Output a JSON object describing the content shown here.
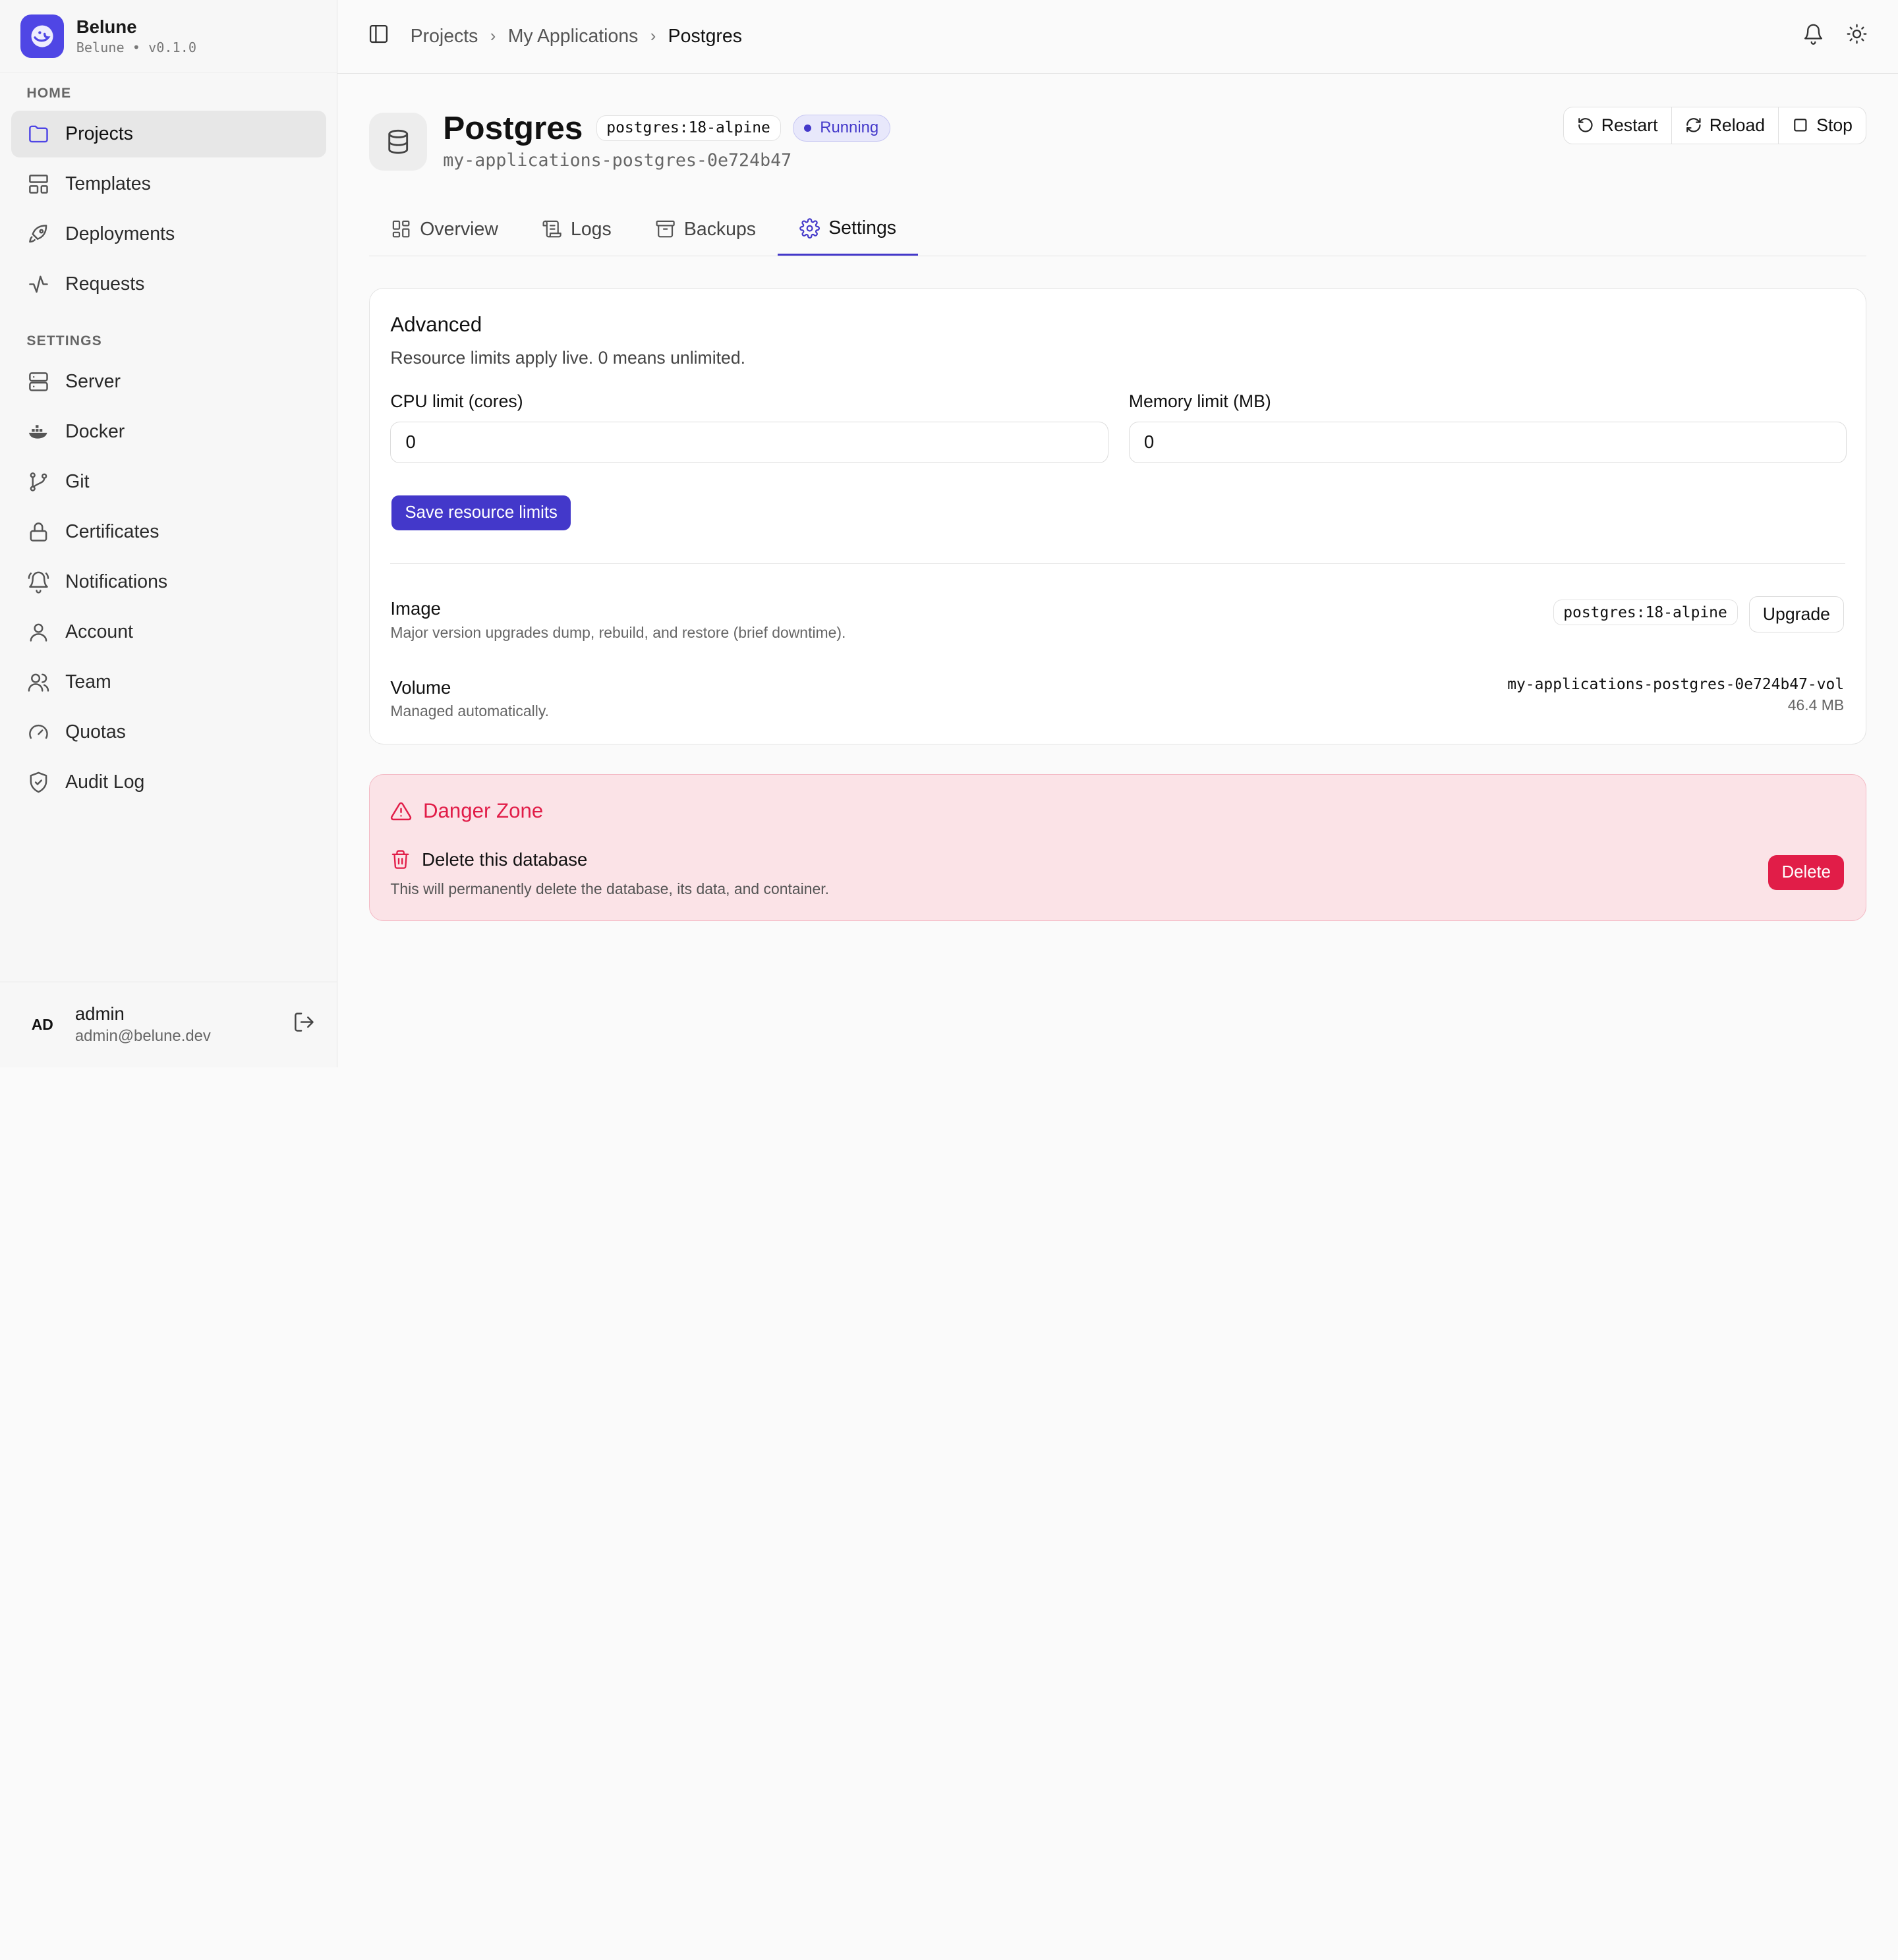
{
  "brand": {
    "name": "Belune",
    "sub": "Belune • v0.1.0"
  },
  "sidebar": {
    "sections": [
      {
        "title": "HOME",
        "items": [
          {
            "label": "Projects",
            "icon": "folder-icon",
            "active": true
          },
          {
            "label": "Templates",
            "icon": "layout-template-icon"
          },
          {
            "label": "Deployments",
            "icon": "rocket-icon"
          },
          {
            "label": "Requests",
            "icon": "activity-icon"
          }
        ]
      },
      {
        "title": "SETTINGS",
        "items": [
          {
            "label": "Server",
            "icon": "server-icon"
          },
          {
            "label": "Docker",
            "icon": "docker-icon"
          },
          {
            "label": "Git",
            "icon": "git-branch-icon"
          },
          {
            "label": "Certificates",
            "icon": "lock-icon"
          },
          {
            "label": "Notifications",
            "icon": "bell-ring-icon"
          },
          {
            "label": "Account",
            "icon": "user-icon"
          },
          {
            "label": "Team",
            "icon": "users-icon"
          },
          {
            "label": "Quotas",
            "icon": "gauge-icon"
          },
          {
            "label": "Audit Log",
            "icon": "shield-check-icon"
          }
        ]
      }
    ]
  },
  "user": {
    "initials": "AD",
    "name": "admin",
    "email": "admin@belune.dev"
  },
  "breadcrumb": [
    "Projects",
    "My Applications",
    "Postgres"
  ],
  "service": {
    "title": "Postgres",
    "image_tag": "postgres:18-alpine",
    "status": "Running",
    "slug": "my-applications-postgres-0e724b47"
  },
  "actions": {
    "restart": "Restart",
    "reload": "Reload",
    "stop": "Stop"
  },
  "tabs": [
    "Overview",
    "Logs",
    "Backups",
    "Settings"
  ],
  "advanced": {
    "title": "Advanced",
    "description": "Resource limits apply live. 0 means unlimited.",
    "cpu_label": "CPU limit (cores)",
    "cpu_value": "0",
    "memory_label": "Memory limit (MB)",
    "memory_value": "0",
    "save_label": "Save resource limits",
    "image_title": "Image",
    "image_desc": "Major version upgrades dump, rebuild, and restore (brief downtime).",
    "image_tag": "postgres:18-alpine",
    "upgrade_label": "Upgrade",
    "volume_title": "Volume",
    "volume_desc": "Managed automatically.",
    "volume_name": "my-applications-postgres-0e724b47-vol",
    "volume_size": "46.4 MB"
  },
  "danger": {
    "title": "Danger Zone",
    "delete_title": "Delete this database",
    "delete_desc": "This will permanently delete the database, its data, and container.",
    "delete_label": "Delete"
  },
  "colors": {
    "accent": "#4338ca",
    "danger": "#e11d48",
    "danger_bg": "#fbe3e7"
  }
}
